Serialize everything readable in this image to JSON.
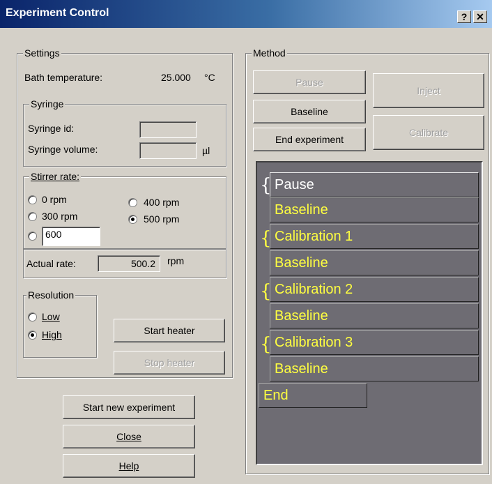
{
  "window": {
    "title": "Experiment Control",
    "help_glyph": "?",
    "close_glyph": "✕"
  },
  "settings": {
    "legend": "Settings",
    "bath_temp_label": "Bath temperature:",
    "bath_temp_value": "25.000",
    "bath_temp_unit": "°C",
    "syringe": {
      "legend": "Syringe",
      "id_label": "Syringe id:",
      "id_value": "",
      "volume_label": "Syringe volume:",
      "volume_value": "",
      "volume_unit": "µl"
    },
    "stirrer": {
      "legend": "Stirrer rate:",
      "opt_0": "0 rpm",
      "opt_300": "300 rpm",
      "opt_400": "400 rpm",
      "opt_500": "500 rpm",
      "custom_value": "600",
      "selected": "500 rpm"
    },
    "actual_rate_label": "Actual rate:",
    "actual_rate_value": "500.2",
    "actual_rate_unit": "rpm",
    "resolution": {
      "legend": "Resolution",
      "low": "Low",
      "high": "High",
      "selected": "High"
    },
    "start_heater": "Start heater",
    "stop_heater": "Stop heater"
  },
  "bottom_buttons": {
    "start_new": "Start new experiment",
    "close": "Close",
    "help": "Help"
  },
  "method": {
    "legend": "Method",
    "pause_btn": "Pause",
    "baseline_btn": "Baseline",
    "end_btn": "End experiment",
    "inject_btn": "Inject",
    "calibrate_btn": "Calibrate",
    "steps": [
      "Pause",
      "Baseline",
      "Calibration 1",
      "Baseline",
      "Calibration 2",
      "Baseline",
      "Calibration 3",
      "Baseline",
      "End"
    ],
    "step_text_color": "#ffff40",
    "background_color": "#6e6c73"
  }
}
